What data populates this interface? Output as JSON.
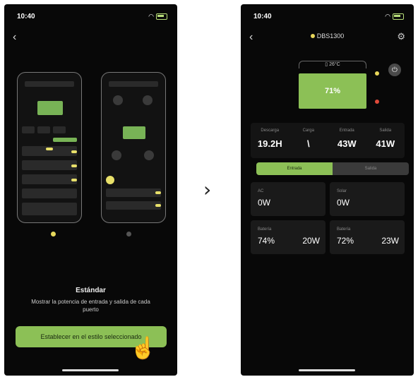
{
  "left": {
    "status": {
      "time": "10:40"
    },
    "style_title": "Estándar",
    "style_desc": "Mostrar la potencia de entrada y salida de cada puerto",
    "select_button": "Establecer en el estilo seleccionado",
    "pager": {
      "count": 2,
      "active": 0
    }
  },
  "right": {
    "status": {
      "time": "10:40"
    },
    "device_name": "DBS1300",
    "battery": {
      "temp": "26°C",
      "level": "71%"
    },
    "stats": [
      {
        "label": "Descarga",
        "value": "19.2H"
      },
      {
        "label": "Carga",
        "value": "\\"
      },
      {
        "label": "Entrada",
        "value": "43W"
      },
      {
        "label": "Salida",
        "value": "41W"
      }
    ],
    "tabs": [
      {
        "label": "Entrada",
        "active": true
      },
      {
        "label": "Salida",
        "active": false
      }
    ],
    "cards": {
      "ac": {
        "label": "AC",
        "value": "0W"
      },
      "solar": {
        "label": "Solar",
        "value": "0W"
      },
      "battery1": {
        "label": "Batería",
        "percent": "74%",
        "power": "20W"
      },
      "battery2": {
        "label": "Batería",
        "percent": "72%",
        "power": "23W"
      }
    }
  },
  "colors": {
    "accent_green": "#8cc056",
    "accent_yellow": "#e8d65a",
    "alert_red": "#e04a3a",
    "bg": "#080808"
  },
  "icons": {
    "back": "chevron-left-icon",
    "settings": "gear-icon",
    "power": "power-icon",
    "arrow": "chevron-right-icon",
    "hand": "tap-hand-icon"
  }
}
